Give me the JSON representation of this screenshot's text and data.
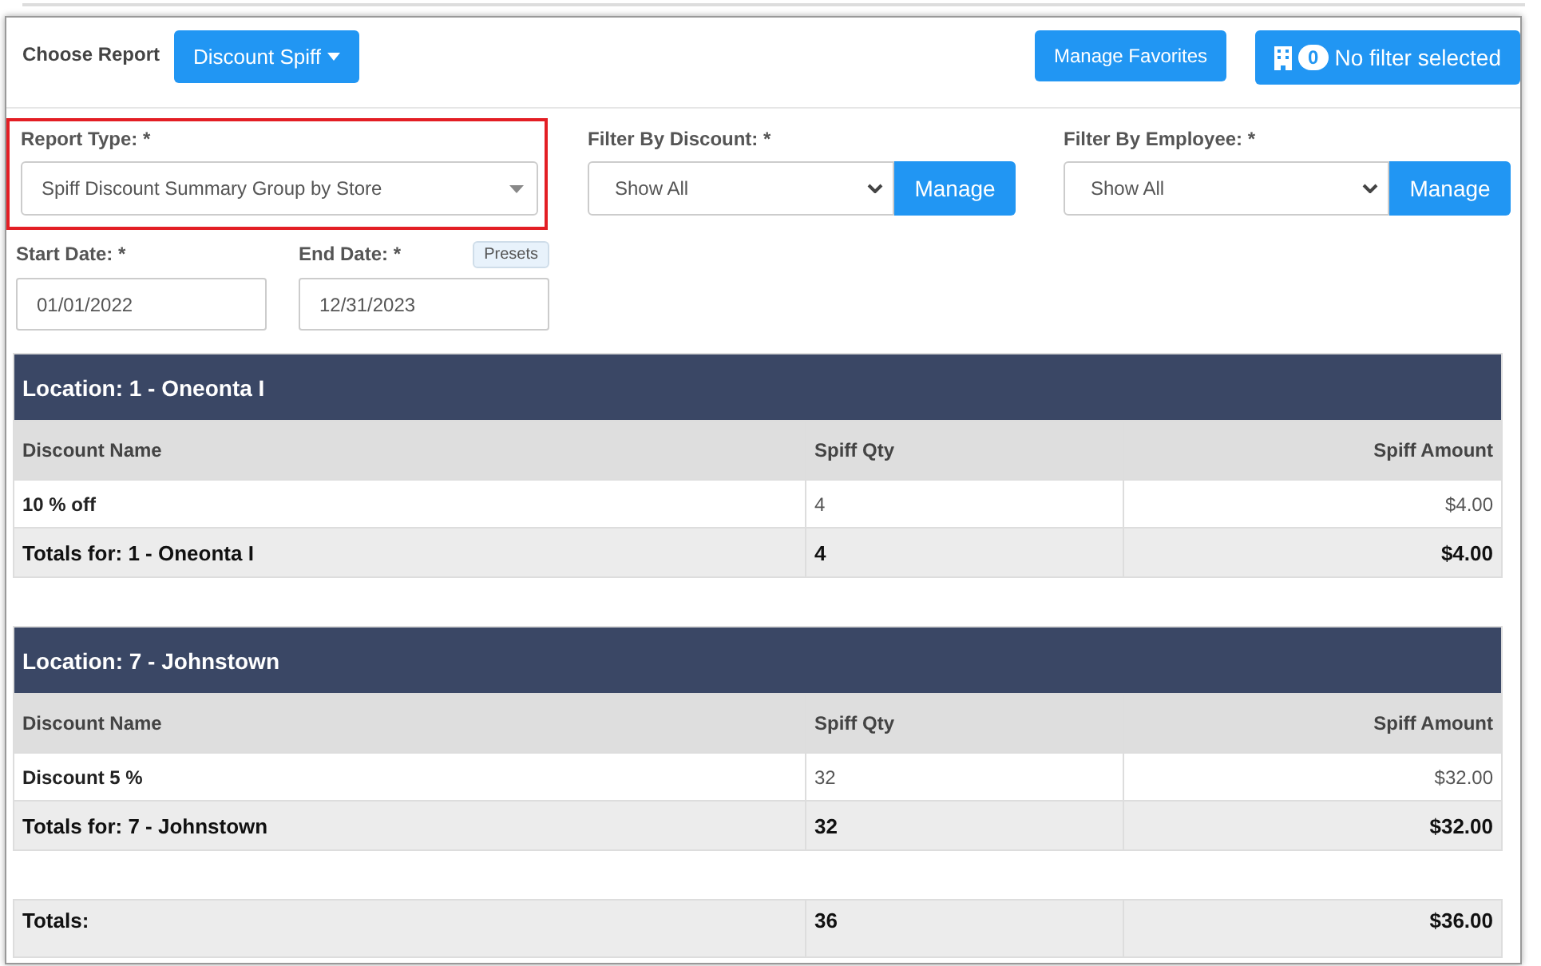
{
  "toolbar": {
    "choose_label": "Choose Report",
    "report_button": "Discount Spiff",
    "favorites_button": "Manage Favorites",
    "filter_count": "0",
    "filter_label": "No filter selected"
  },
  "filters": {
    "report_type": {
      "label": "Report Type: *",
      "value": "Spiff Discount Summary Group by Store",
      "highlighted": true
    },
    "discount": {
      "label": "Filter By Discount: *",
      "value": "Show All",
      "manage": "Manage"
    },
    "employee": {
      "label": "Filter By Employee: *",
      "value": "Show All",
      "manage": "Manage"
    },
    "start_date": {
      "label": "Start Date: *",
      "value": "01/01/2022"
    },
    "end_date": {
      "label": "End Date: *",
      "value": "12/31/2023"
    },
    "presets": "Presets"
  },
  "sections": [
    {
      "title": "Location: 1 - Oneonta I",
      "columns": [
        "Discount Name",
        "Spiff Qty",
        "Spiff Amount"
      ],
      "rows": [
        [
          "10 % off",
          "4",
          "$4.00"
        ]
      ],
      "totals": [
        "Totals for: 1 - Oneonta I",
        "4",
        "$4.00"
      ]
    },
    {
      "title": "Location: 7 - Johnstown",
      "columns": [
        "Discount Name",
        "Spiff Qty",
        "Spiff Amount"
      ],
      "rows": [
        [
          "Discount 5 %",
          "32",
          "$32.00"
        ]
      ],
      "totals": [
        "Totals for: 7 - Johnstown",
        "32",
        "$32.00"
      ]
    }
  ],
  "grand_totals": [
    "Totals:",
    "36",
    "$36.00"
  ]
}
